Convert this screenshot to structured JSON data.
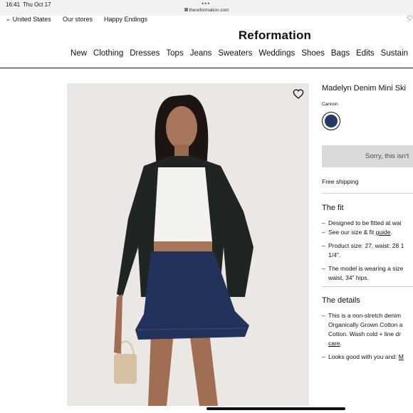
{
  "status_bar": {
    "time": "16:41",
    "date": "Thu Oct 17",
    "url": "thereformation.com"
  },
  "util_bar": {
    "country": "United States",
    "stores": "Our stores",
    "endings": "Happy Endings",
    "wishlist_icon": "heart-icon"
  },
  "logo": "Reformation",
  "nav": {
    "items": [
      "New",
      "Clothing",
      "Dresses",
      "Tops",
      "Jeans",
      "Sweaters",
      "Weddings",
      "Shoes",
      "Bags",
      "Edits",
      "Sustain"
    ]
  },
  "product": {
    "title": "Madelyn Denim Mini Ski",
    "color_name": "Cannon",
    "swatch_color": "#253a61",
    "button": "Sorry, this isn't",
    "shipping": "Free shipping",
    "wishlist_icon": "heart-outline-icon",
    "image_bg": "#ebe7e4"
  },
  "fit": {
    "title": "The fit",
    "b1_l1": "Designed to be fitted at wai",
    "b1_l2_pre": "See our size & fit ",
    "b1_l2_link": "guide",
    "b1_l2_post": ".",
    "b2_l1": "Product size: 27, waist: 28 1",
    "b2_l2": "1/4\".",
    "b3_l1": "The model is wearing a size",
    "b3_l2": "waist, 34\" hips."
  },
  "details": {
    "title": "The details",
    "b1_l1": "This is a non-stretch denim",
    "b1_l2": "Organically Grown Cotton a",
    "b1_l3": "Cotton. Wash cold + line dr",
    "b1_l4_link": "care",
    "b1_l4_post": ".",
    "b2_pre": "Looks good with you and: ",
    "b2_link": "M"
  }
}
